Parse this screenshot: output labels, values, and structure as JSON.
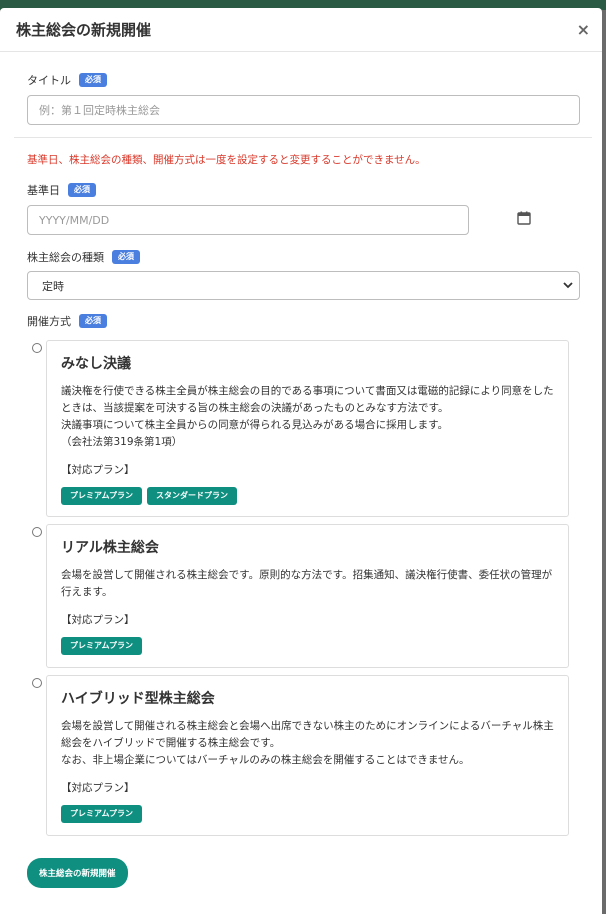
{
  "modal": {
    "title": "株主総会の新規開催",
    "close_label": "×"
  },
  "form": {
    "title_field": {
      "label": "タイトル",
      "required": "必須",
      "placeholder": "例：第１回定時株主総会"
    },
    "warning": "基準日、株主総会の種類、開催方式は一度を設定すると変更することができません。",
    "date_field": {
      "label": "基準日",
      "required": "必須",
      "placeholder": "YYYY/MM/DD"
    },
    "type_field": {
      "label": "株主総会の種類",
      "required": "必須",
      "selected": "定時"
    },
    "method_field": {
      "label": "開催方式",
      "required": "必須"
    }
  },
  "methods": [
    {
      "title": "みなし決議",
      "description": "議決権を行使できる株主全員が株主総会の目的である事項について書面又は電磁的記録により同意をしたときは、当該提案を可決する旨の株主総会の決議があったものとみなす方法です。\n決議事項について株主全員からの同意が得られる見込みがある場合に採用します。\n（会社法第319条第1項）",
      "plans_label": "【対応プラン】",
      "plans": [
        "プレミアムプラン",
        "スタンダードプラン"
      ]
    },
    {
      "title": "リアル株主総会",
      "description": "会場を設営して開催される株主総会です。原則的な方法です。招集通知、議決権行使書、委任状の管理が行えます。",
      "plans_label": "【対応プラン】",
      "plans": [
        "プレミアムプラン"
      ]
    },
    {
      "title": "ハイブリッド型株主総会",
      "description": "会場を設営して開催される株主総会と会場へ出席できない株主のためにオンラインによるバーチャル株主総会をハイブリッドで開催する株主総会です。\nなお、非上場企業についてはバーチャルのみの株主総会を開催することはできません。",
      "plans_label": "【対応プラン】",
      "plans": [
        "プレミアムプラン"
      ]
    }
  ],
  "submit_label": "株主総会の新規開催",
  "colors": {
    "accent_teal": "#0f8f80",
    "required_blue": "#4a7fe0",
    "warning_red": "#d9392b"
  }
}
